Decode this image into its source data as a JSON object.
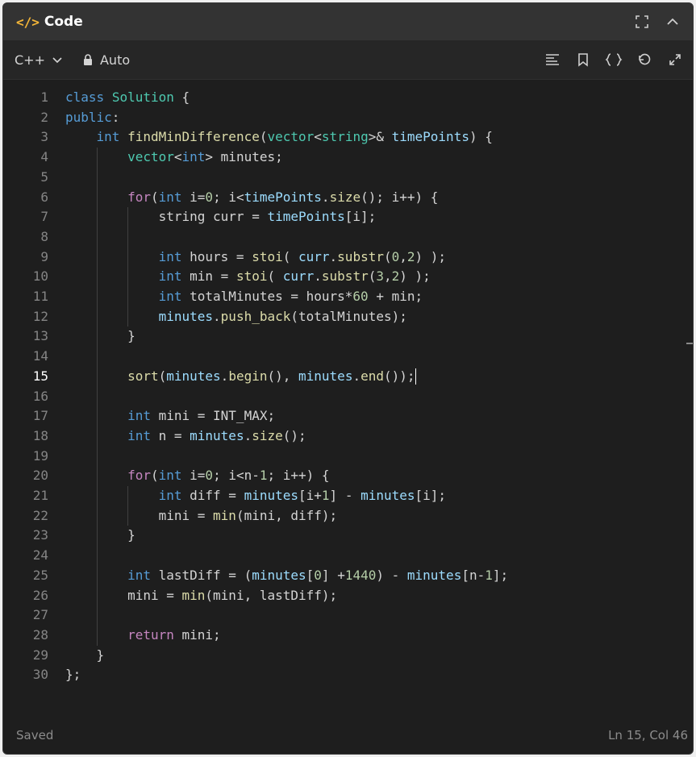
{
  "header": {
    "title": "Code",
    "icon": "code-icon"
  },
  "toolbar": {
    "language": "C++",
    "mode": "Auto"
  },
  "footer": {
    "status": "Saved",
    "cursor_position": "Ln 15, Col 46"
  },
  "editor": {
    "active_line": 15,
    "lines": [
      {
        "n": "1"
      },
      {
        "n": "2"
      },
      {
        "n": "3"
      },
      {
        "n": "4"
      },
      {
        "n": "5"
      },
      {
        "n": "6"
      },
      {
        "n": "7"
      },
      {
        "n": "8"
      },
      {
        "n": "9"
      },
      {
        "n": "10"
      },
      {
        "n": "11"
      },
      {
        "n": "12"
      },
      {
        "n": "13"
      },
      {
        "n": "14"
      },
      {
        "n": "15"
      },
      {
        "n": "16"
      },
      {
        "n": "17"
      },
      {
        "n": "18"
      },
      {
        "n": "19"
      },
      {
        "n": "20"
      },
      {
        "n": "21"
      },
      {
        "n": "22"
      },
      {
        "n": "23"
      },
      {
        "n": "24"
      },
      {
        "n": "25"
      },
      {
        "n": "26"
      },
      {
        "n": "27"
      },
      {
        "n": "28"
      },
      {
        "n": "29"
      },
      {
        "n": "30"
      }
    ],
    "tokens": [
      [
        [
          "k",
          "class"
        ],
        [
          "p",
          " "
        ],
        [
          "t",
          "Solution"
        ],
        [
          "p",
          " {"
        ]
      ],
      [
        [
          "k",
          "public"
        ],
        [
          "p",
          ":"
        ]
      ],
      [
        [
          "p",
          "    "
        ],
        [
          "k",
          "int"
        ],
        [
          "p",
          " "
        ],
        [
          "f",
          "findMinDifference"
        ],
        [
          "p",
          "("
        ],
        [
          "t",
          "vector"
        ],
        [
          "p",
          "<"
        ],
        [
          "t",
          "string"
        ],
        [
          "p",
          ">& "
        ],
        [
          "v",
          "timePoints"
        ],
        [
          "p",
          ") {"
        ]
      ],
      [
        [
          "p",
          "        "
        ],
        [
          "t",
          "vector"
        ],
        [
          "p",
          "<"
        ],
        [
          "k",
          "int"
        ],
        [
          "p",
          "> "
        ],
        [
          "p",
          "minutes;"
        ]
      ],
      [],
      [
        [
          "p",
          "        "
        ],
        [
          "c",
          "for"
        ],
        [
          "p",
          "("
        ],
        [
          "k",
          "int"
        ],
        [
          "p",
          " i="
        ],
        [
          "n",
          "0"
        ],
        [
          "p",
          "; i<"
        ],
        [
          "v",
          "timePoints"
        ],
        [
          "p",
          "."
        ],
        [
          "f",
          "size"
        ],
        [
          "p",
          "(); i++) {"
        ]
      ],
      [
        [
          "p",
          "            "
        ],
        [
          "p",
          "string curr = "
        ],
        [
          "v",
          "timePoints"
        ],
        [
          "p",
          "[i];"
        ]
      ],
      [],
      [
        [
          "p",
          "            "
        ],
        [
          "k",
          "int"
        ],
        [
          "p",
          " hours = "
        ],
        [
          "f",
          "stoi"
        ],
        [
          "p",
          "( "
        ],
        [
          "v",
          "curr"
        ],
        [
          "p",
          "."
        ],
        [
          "f",
          "substr"
        ],
        [
          "p",
          "("
        ],
        [
          "n",
          "0"
        ],
        [
          "p",
          ","
        ],
        [
          "n",
          "2"
        ],
        [
          "p",
          ") );"
        ]
      ],
      [
        [
          "p",
          "            "
        ],
        [
          "k",
          "int"
        ],
        [
          "p",
          " min = "
        ],
        [
          "f",
          "stoi"
        ],
        [
          "p",
          "( "
        ],
        [
          "v",
          "curr"
        ],
        [
          "p",
          "."
        ],
        [
          "f",
          "substr"
        ],
        [
          "p",
          "("
        ],
        [
          "n",
          "3"
        ],
        [
          "p",
          ","
        ],
        [
          "n",
          "2"
        ],
        [
          "p",
          ") );"
        ]
      ],
      [
        [
          "p",
          "            "
        ],
        [
          "k",
          "int"
        ],
        [
          "p",
          " totalMinutes = hours*"
        ],
        [
          "n",
          "60"
        ],
        [
          "p",
          " + min;"
        ]
      ],
      [
        [
          "p",
          "            "
        ],
        [
          "v",
          "minutes"
        ],
        [
          "p",
          "."
        ],
        [
          "f",
          "push_back"
        ],
        [
          "p",
          "(totalMinutes);"
        ]
      ],
      [
        [
          "p",
          "        }"
        ]
      ],
      [],
      [
        [
          "p",
          "        "
        ],
        [
          "f",
          "sort"
        ],
        [
          "p",
          "("
        ],
        [
          "v",
          "minutes"
        ],
        [
          "p",
          "."
        ],
        [
          "f",
          "begin"
        ],
        [
          "p",
          "(), "
        ],
        [
          "v",
          "minutes"
        ],
        [
          "p",
          "."
        ],
        [
          "f",
          "end"
        ],
        [
          "p",
          "());"
        ]
      ],
      [],
      [
        [
          "p",
          "        "
        ],
        [
          "k",
          "int"
        ],
        [
          "p",
          " mini = INT_MAX;"
        ]
      ],
      [
        [
          "p",
          "        "
        ],
        [
          "k",
          "int"
        ],
        [
          "p",
          " n = "
        ],
        [
          "v",
          "minutes"
        ],
        [
          "p",
          "."
        ],
        [
          "f",
          "size"
        ],
        [
          "p",
          "();"
        ]
      ],
      [],
      [
        [
          "p",
          "        "
        ],
        [
          "c",
          "for"
        ],
        [
          "p",
          "("
        ],
        [
          "k",
          "int"
        ],
        [
          "p",
          " i="
        ],
        [
          "n",
          "0"
        ],
        [
          "p",
          "; i<n-"
        ],
        [
          "n",
          "1"
        ],
        [
          "p",
          "; i++) {"
        ]
      ],
      [
        [
          "p",
          "            "
        ],
        [
          "k",
          "int"
        ],
        [
          "p",
          " diff = "
        ],
        [
          "v",
          "minutes"
        ],
        [
          "p",
          "[i+"
        ],
        [
          "n",
          "1"
        ],
        [
          "p",
          "] - "
        ],
        [
          "v",
          "minutes"
        ],
        [
          "p",
          "[i];"
        ]
      ],
      [
        [
          "p",
          "            "
        ],
        [
          "p",
          "mini = "
        ],
        [
          "f",
          "min"
        ],
        [
          "p",
          "(mini, diff);"
        ]
      ],
      [
        [
          "p",
          "        }"
        ]
      ],
      [],
      [
        [
          "p",
          "        "
        ],
        [
          "k",
          "int"
        ],
        [
          "p",
          " lastDiff = ("
        ],
        [
          "v",
          "minutes"
        ],
        [
          "p",
          "["
        ],
        [
          "n",
          "0"
        ],
        [
          "p",
          "] +"
        ],
        [
          "n",
          "1440"
        ],
        [
          "p",
          ") - "
        ],
        [
          "v",
          "minutes"
        ],
        [
          "p",
          "[n-"
        ],
        [
          "n",
          "1"
        ],
        [
          "p",
          "];"
        ]
      ],
      [
        [
          "p",
          "        "
        ],
        [
          "p",
          "mini = "
        ],
        [
          "f",
          "min"
        ],
        [
          "p",
          "(mini, lastDiff);"
        ]
      ],
      [],
      [
        [
          "p",
          "        "
        ],
        [
          "c",
          "return"
        ],
        [
          "p",
          " mini;"
        ]
      ],
      [
        [
          "p",
          "    }"
        ]
      ],
      [
        [
          "p",
          "};"
        ]
      ]
    ]
  }
}
